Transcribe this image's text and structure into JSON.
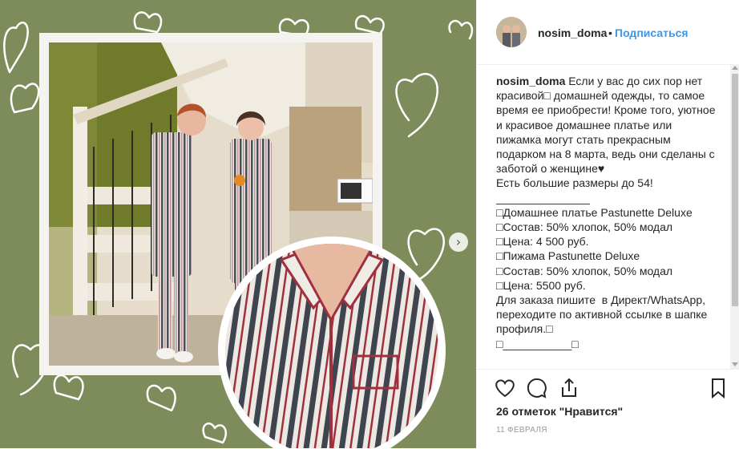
{
  "header": {
    "username": "nosim_doma",
    "separator": "•",
    "follow_label": "Подписаться"
  },
  "caption": {
    "username": "nosim_doma",
    "lines": [
      "Если у вас до сих пор нет красивой□ домашней одежды, то самое время ее приобрести! Кроме того, уютное и красивое домашнее платье или пижамка могут стать прекрасным подарком на 8 марта, ведь они сделаны с заботой о женщине♥",
      "",
      "Есть большие размеры до 54!",
      "_______________",
      "□Домашнее платье Pastunette Deluxe",
      "□Состав: 50% хлопок, 50% модал",
      "□Цена: 4 500 руб.",
      "□Пижама Pastunette Deluxe",
      "□Состав: 50% хлопок, 50% модал",
      "□Цена: 5500 руб.",
      "Для заказа пишите  в Директ/WhatsApp, переходите по активной ссылке в шапке профиля.□",
      "",
      "□___________□"
    ]
  },
  "stats": {
    "likes": "26 отметок \"Нравится\"",
    "date": "11 ФЕВРАЛЯ"
  },
  "icons": {
    "like": "heart-icon",
    "comment": "comment-icon",
    "share": "share-icon",
    "save": "bookmark-icon",
    "next": "chevron-right-icon"
  },
  "colors": {
    "media_background": "#7d8c5a",
    "follow": "#3897f0",
    "text": "#262626",
    "muted": "#999999"
  }
}
